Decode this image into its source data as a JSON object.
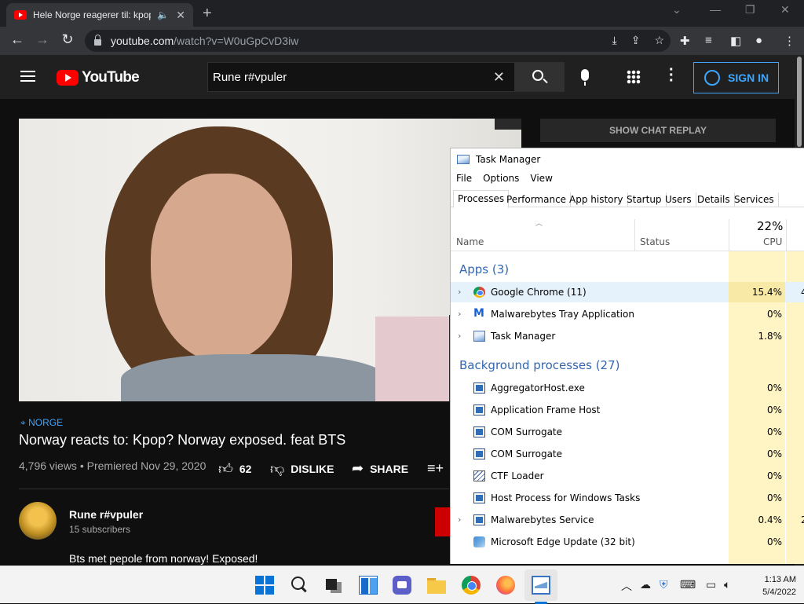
{
  "browser": {
    "tab_title": "Hele Norge reagerer til: kpop",
    "url_host": "youtube.com",
    "url_path": "/watch?v=W0uGpCvD3iw"
  },
  "youtube": {
    "logo_text": "YouTube",
    "search_query": "Rune r#vpuler",
    "sign_in_label": "SIGN IN",
    "chat_replay_label": "SHOW CHAT REPLAY",
    "location_tag": "NORGE",
    "video_title": "Norway reacts to: Kpop? Norway exposed. feat BTS",
    "views": "4,796 views",
    "premiered": "Premiered Nov 29, 2020",
    "likes": "62",
    "dislike_label": "DISLIKE",
    "share_label": "SHARE",
    "channel_name": "Rune r#vpuler",
    "subscribers": "15 subscribers",
    "description": "Bts met pepole from norway! Exposed!"
  },
  "task_manager": {
    "title": "Task Manager",
    "menu": [
      "File",
      "Options",
      "View"
    ],
    "tabs": [
      "Processes",
      "Performance",
      "App history",
      "Startup",
      "Users",
      "Details",
      "Services"
    ],
    "active_tab": "Processes",
    "columns": {
      "name": "Name",
      "status": "Status",
      "cpu_total": "22%",
      "cpu": "CPU"
    },
    "groups": {
      "apps": "Apps (3)",
      "background": "Background processes (27)"
    },
    "apps": [
      {
        "name": "Google Chrome (11)",
        "cpu": "15.4%",
        "mem_fragment": "4",
        "icon": "chrome-icon",
        "expandable": true
      },
      {
        "name": "Malwarebytes Tray Application",
        "cpu": "0%",
        "mem_fragment": "",
        "icon": "malwarebytes-icon",
        "expandable": true
      },
      {
        "name": "Task Manager",
        "cpu": "1.8%",
        "mem_fragment": "",
        "icon": "task-manager-icon",
        "expandable": true
      }
    ],
    "background": [
      {
        "name": "AggregatorHost.exe",
        "cpu": "0%",
        "mem_fragment": "",
        "icon": "process-icon",
        "expandable": false
      },
      {
        "name": "Application Frame Host",
        "cpu": "0%",
        "mem_fragment": "",
        "icon": "process-icon",
        "expandable": false
      },
      {
        "name": "COM Surrogate",
        "cpu": "0%",
        "mem_fragment": "",
        "icon": "process-icon",
        "expandable": false
      },
      {
        "name": "COM Surrogate",
        "cpu": "0%",
        "mem_fragment": "",
        "icon": "process-icon",
        "expandable": false
      },
      {
        "name": "CTF Loader",
        "cpu": "0%",
        "mem_fragment": "",
        "icon": "ctf-icon",
        "expandable": false
      },
      {
        "name": "Host Process for Windows Tasks",
        "cpu": "0%",
        "mem_fragment": "",
        "icon": "process-icon",
        "expandable": false
      },
      {
        "name": "Malwarebytes Service",
        "cpu": "0.4%",
        "mem_fragment": "2",
        "icon": "process-icon",
        "expandable": true
      },
      {
        "name": "Microsoft Edge Update (32 bit)",
        "cpu": "0%",
        "mem_fragment": "",
        "icon": "edge-update-icon",
        "expandable": false
      }
    ]
  },
  "taskbar": {
    "time": "1:13 AM",
    "date": "5/4/2022"
  }
}
